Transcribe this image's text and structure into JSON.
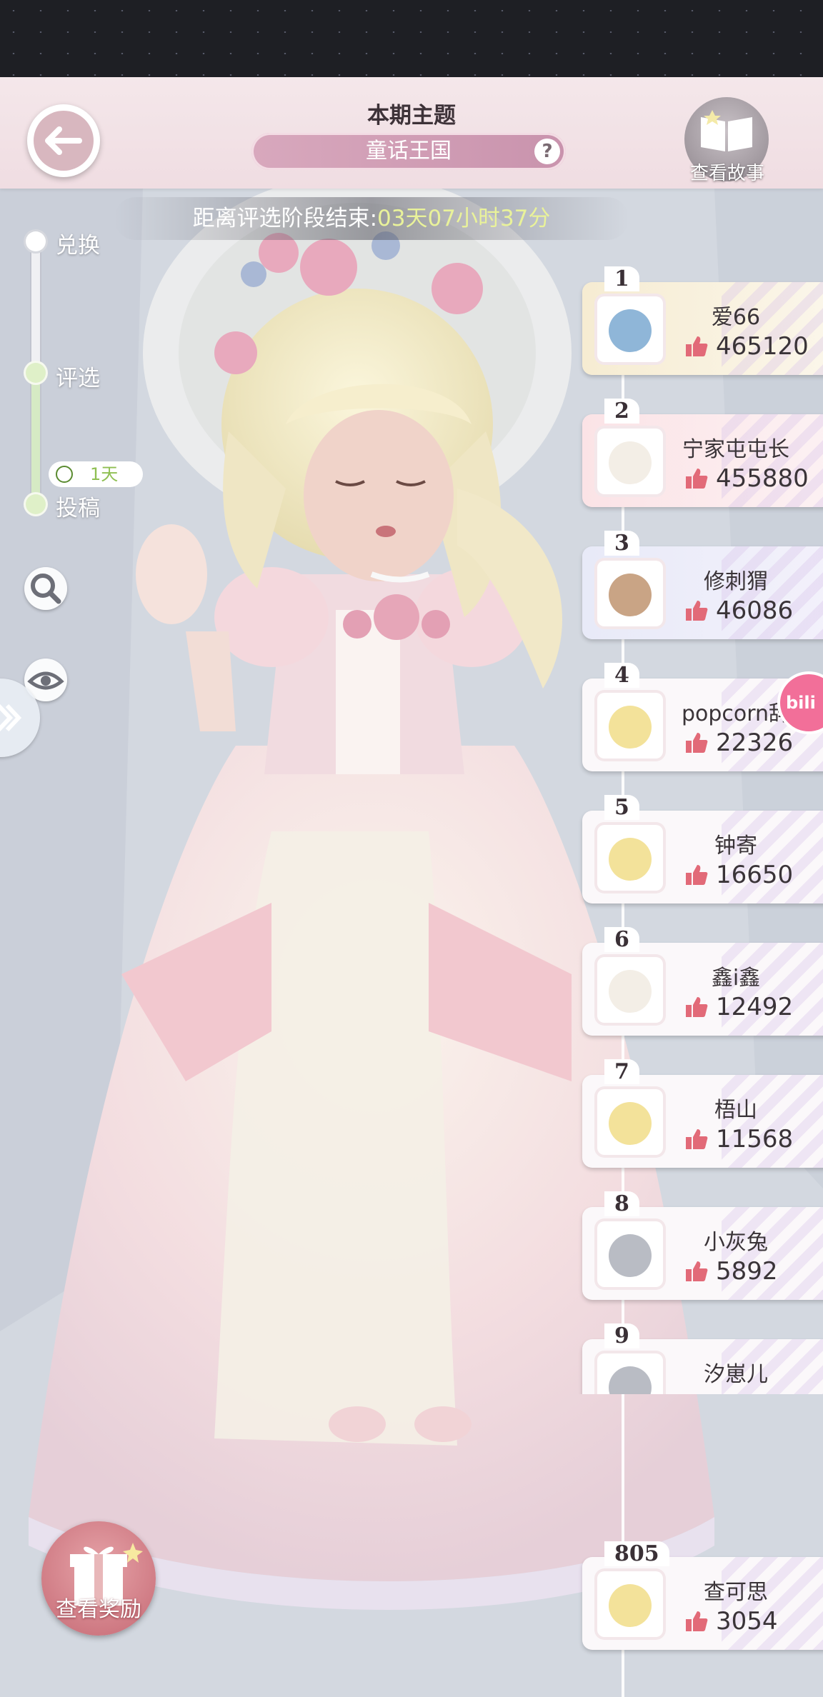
{
  "header": {
    "title": "本期主题",
    "theme": "童话王国",
    "help_symbol": "?",
    "story_label": "查看故事"
  },
  "countdown": {
    "prefix": "距离评选阶段结束:",
    "time": "03天07小时37分"
  },
  "stages": [
    {
      "label": "兑换"
    },
    {
      "label": "评选"
    },
    {
      "label": "投稿"
    }
  ],
  "submit_badge": "1天",
  "gift_label": "查看奖励",
  "bili_text": "bili",
  "colors": {
    "accent_pink": "#c993ad",
    "time_green": "#e9f29a",
    "thumb": "#e26a78"
  },
  "leaderboard": [
    {
      "rank": "1",
      "name": "爱66",
      "likes": "465120",
      "style": "gold"
    },
    {
      "rank": "2",
      "name": "宁家屯屯长",
      "likes": "455880",
      "style": "pink"
    },
    {
      "rank": "3",
      "name": "修刺猬",
      "likes": "46086",
      "style": "blue"
    },
    {
      "rank": "4",
      "name": "popcorn辞",
      "likes": "22326",
      "style": "plain"
    },
    {
      "rank": "5",
      "name": "钟寄",
      "likes": "16650",
      "style": "plain"
    },
    {
      "rank": "6",
      "name": "鑫i鑫",
      "likes": "12492",
      "style": "plain"
    },
    {
      "rank": "7",
      "name": "梧山",
      "likes": "11568",
      "style": "plain"
    },
    {
      "rank": "8",
      "name": "小灰兔",
      "likes": "5892",
      "style": "plain"
    },
    {
      "rank": "9",
      "name": "汐崽儿",
      "likes": "",
      "style": "plain"
    }
  ],
  "my_rank": {
    "rank": "805",
    "name": "查可思",
    "likes": "3054"
  }
}
